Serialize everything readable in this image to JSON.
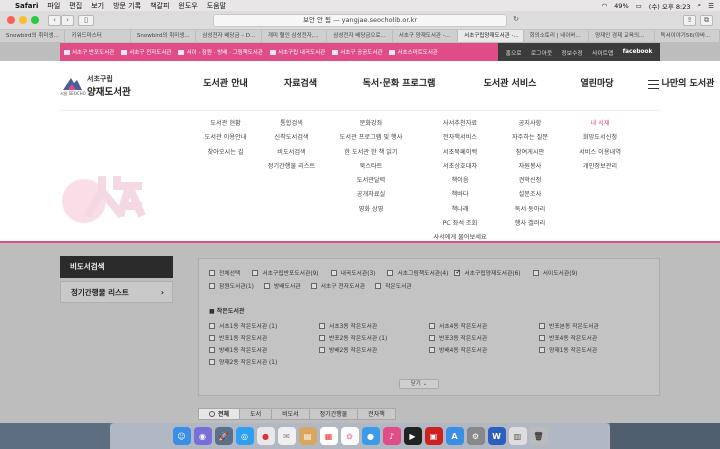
{
  "menubar": {
    "app": "Safari",
    "items": [
      "파일",
      "편집",
      "보기",
      "방문 기록",
      "책갈피",
      "윈도우",
      "도움말"
    ],
    "battery": "49%",
    "clock": "(수) 오후 8:23"
  },
  "browser": {
    "url": "보안 안 됨 — yangjae.seocholib.or.kr",
    "tabs": [
      "Snowbird의 취미생...",
      "키워드마스터",
      "Snowbird의 취미생...",
      "삼성전자 배당금 – D...",
      "개미 혈인 삼성전자,...",
      "삼성전자 배당금으로...",
      "서초구 양재도서관 -...",
      "서초구립양재도서관 -...",
      "회의소토리 | 네이버...",
      "양재인 경제 교육의...",
      "독서이야기56(아바..."
    ]
  },
  "topbar": {
    "links": [
      "서초구 반포도서관",
      "서초구 전자도서관",
      "서이 · 잠원 · 방배 · 그림책도서관",
      "서초구립 내곡도서관",
      "서초구 공공도서관",
      "서초스마트도서관"
    ],
    "util": [
      "홈으로",
      "로그아웃",
      "정보수정",
      "사이트맵",
      "facebook"
    ]
  },
  "logo": {
    "small": "서초구립",
    "big": "양재도서관",
    "mark": "서울 SEOCHO"
  },
  "gnb": {
    "menus": [
      {
        "label": "도서관 안내",
        "sub": [
          "도서관 현황",
          "도서관 이용안내",
          "찾아오시는 길"
        ]
      },
      {
        "label": "자료검색",
        "sub": [
          "통합검색",
          "신착도서검색",
          "비도서검색",
          "정기간행물 리스트"
        ]
      },
      {
        "label": "독서·문화 프로그램",
        "sub": [
          "문화강좌",
          "도서관 프로그램 및 행사",
          "한 도서관 한 책 읽기",
          "북스타트",
          "도서관달력",
          "공개자료실",
          "영화 상영"
        ]
      },
      {
        "label": "도서관 서비스",
        "sub": [
          "사서추천자료",
          "전자책서비스",
          "서초북페이백",
          "서초상호대차",
          "책이음",
          "책바다",
          "책나래",
          "PC 좌석 조회",
          "사서에게 물어보세요"
        ]
      },
      {
        "label": "열린마당",
        "sub": [
          "공지사항",
          "자주하는 질문",
          "참여게시판",
          "자원봉사",
          "견학신청",
          "설문조사",
          "독서 동아리",
          "행사 갤러리"
        ]
      },
      {
        "label": "나만의 도서관",
        "sub": [
          "내 서재",
          "희망도서신청",
          "서비스 이용내역",
          "개인정보관리"
        ]
      }
    ]
  },
  "sidebar": {
    "items": [
      "비도서검색",
      "정기간행물 리스트"
    ]
  },
  "filter": {
    "top_row": [
      "전체선택",
      "서초구립반포도서관(9)",
      "내곡도서관(3)",
      "서초그림책도서관(4)",
      "서초구립양재도서관(6)",
      "서이도서관(9)"
    ],
    "second_row": [
      "잠원도서관(1)",
      "방배도서관",
      "서초구 전자도서관",
      "작은도서관"
    ],
    "section_title": "작은도서관",
    "small_libs": [
      "서초1동 작은도서관 (1)",
      "서초3동 작은도서관",
      "서초4동 작은도서관",
      "반포본동 작은도서관",
      "반포1동 작은도서관",
      "반포2동 작은도서관 (1)",
      "반포3동 작은도서관",
      "반포4동 작은도서관",
      "방배1동 작은도서관",
      "방배2동 작은도서관",
      "방배4동 작은도서관",
      "양재1동 작은도서관",
      "양재2동 작은도서관 (1)"
    ],
    "fold": "닫기 ⌄"
  },
  "bottom_tabs": [
    "전체",
    "도서",
    "비도서",
    "정기간행물",
    "전자책"
  ],
  "colors": {
    "accent": "#e04c86",
    "dark": "#3b3b3b"
  }
}
